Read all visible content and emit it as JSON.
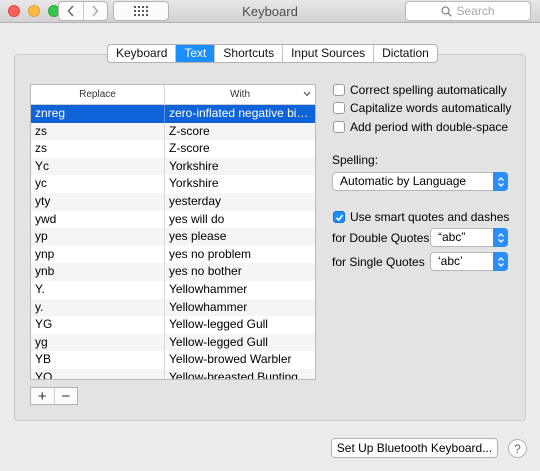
{
  "window": {
    "title": "Keyboard"
  },
  "search": {
    "placeholder": "Search"
  },
  "tabs": [
    {
      "label": "Keyboard",
      "active": false
    },
    {
      "label": "Text",
      "active": true
    },
    {
      "label": "Shortcuts",
      "active": false
    },
    {
      "label": "Input Sources",
      "active": false
    },
    {
      "label": "Dictation",
      "active": false
    }
  ],
  "table": {
    "headers": {
      "replace": "Replace",
      "with": "With"
    },
    "rows": [
      {
        "replace": "znreg",
        "with": "zero-inflated negative bino...",
        "selected": true
      },
      {
        "replace": "zs",
        "with": "Z-score"
      },
      {
        "replace": "zs",
        "with": "Z-score"
      },
      {
        "replace": "Yc",
        "with": "Yorkshire"
      },
      {
        "replace": "yc",
        "with": "Yorkshire"
      },
      {
        "replace": "yty",
        "with": "yesterday"
      },
      {
        "replace": "ywd",
        "with": "yes will do"
      },
      {
        "replace": "yp",
        "with": "yes please"
      },
      {
        "replace": "ynp",
        "with": "yes no problem"
      },
      {
        "replace": "ynb",
        "with": "yes no bother"
      },
      {
        "replace": "Y.",
        "with": "Yellowhammer"
      },
      {
        "replace": "y.",
        "with": "Yellowhammer"
      },
      {
        "replace": "YG",
        "with": "Yellow-legged Gull"
      },
      {
        "replace": "yg",
        "with": "Yellow-legged Gull"
      },
      {
        "replace": "YB",
        "with": "Yellow-browed Warbler"
      },
      {
        "replace": "YO",
        "with": "Yellow-breasted Bunting"
      }
    ]
  },
  "buttons": {
    "add": "+",
    "remove": "−"
  },
  "options": {
    "correct_spelling": "Correct spelling automatically",
    "capitalize": "Capitalize words automatically",
    "add_period": "Add period with double-space",
    "spelling_label": "Spelling:",
    "spelling_value": "Automatic by Language",
    "smart_quotes": "Use smart quotes and dashes",
    "double_label": "for Double Quotes",
    "double_value": "“abc”",
    "single_label": "for Single Quotes",
    "single_value": "‘abc’"
  },
  "footer": {
    "bluetooth_button": "Set Up Bluetooth Keyboard...",
    "help": "?"
  }
}
